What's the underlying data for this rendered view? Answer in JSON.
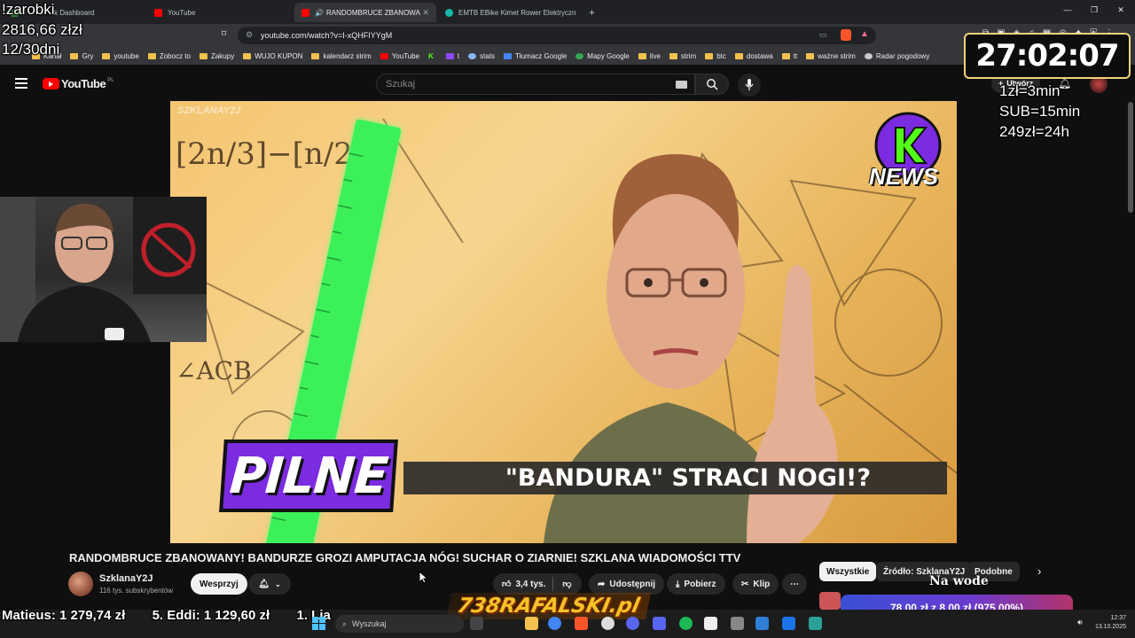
{
  "browser": {
    "tabs": [
      {
        "label": "k Dashboard",
        "active": false
      },
      {
        "label": "YouTube",
        "active": false
      },
      {
        "label": "RANDOMBRUCE ZBANOWAN",
        "active": true
      },
      {
        "label": "EMTB EBike Kimet Rower Elektryczny",
        "active": false
      }
    ],
    "url": "youtube.com/watch?v=I-xQHFIYYgM",
    "bookmarks": [
      "Kanał",
      "Gry",
      "youtube",
      "Zobocz to",
      "Zakupy",
      "WUJO KUPON",
      "kalendarz strim",
      "YouTube",
      "t",
      "stats",
      "Tłumacz Google",
      "Mapy Google",
      "live",
      "strim",
      "btc",
      "dostawa",
      "tt",
      "ważne strim",
      "Radar pogodowy"
    ]
  },
  "youtube": {
    "logo_text": "YouTube",
    "logo_region": "PL",
    "search_placeholder": "Szukaj",
    "create_label": "Utwórz",
    "video": {
      "watermark": "SZKLANAY2J",
      "pilne": "PILNE",
      "headline": "\"BANDURA\" STRACI NOGI!?",
      "news_badge": "NEWS",
      "formula_left": "[2n/3]−[n/2]",
      "formula_angle": "∠ACB"
    },
    "title": "RANDOMBRUCE ZBANOWANY! BANDURZE GROZI AMPUTACJA NÓG! SUCHAR O ZIARNIE! SZKLANA WIADOMOŚCI TTV",
    "channel": {
      "name": "SzklanaY2J",
      "subscribers": "116 tys. subskrybentów",
      "support_label": "Wesprzyj"
    },
    "actions": {
      "likes": "3,4 tys.",
      "share": "Udostępnij",
      "download": "Pobierz",
      "clip": "Klip"
    },
    "chips": [
      "Wszystkie",
      "Źródło: SzklanaY2J",
      "Podobne"
    ]
  },
  "overlay": {
    "zarobki_label": "!zarobki",
    "zarobki_value": "2816,66 złzł",
    "days": "12/30dni",
    "timer": "27:02:07",
    "rates": [
      "1zł=3min",
      "SUB=15min",
      "249zł=24h"
    ],
    "ticker": [
      "Matieus: 1 279,74 zł",
      "5. Eddi: 1 129,60 zł",
      "1. Lia"
    ],
    "logo_text": "738RAFALSKI.pl",
    "na_wode": "Na wode",
    "goal": "78,00 zł z 8,00 zł (975.00%)"
  },
  "taskbar": {
    "search_placeholder": "Wyszukaj",
    "time": "12:37",
    "date": "13.10.2025"
  },
  "colors": {
    "yt_red": "#ff0000",
    "timer_border": "#f2d27a",
    "goal_bg": "#3b4fd6",
    "pilne_bg": "#7b2be0",
    "ruler": "#3cf05a"
  }
}
